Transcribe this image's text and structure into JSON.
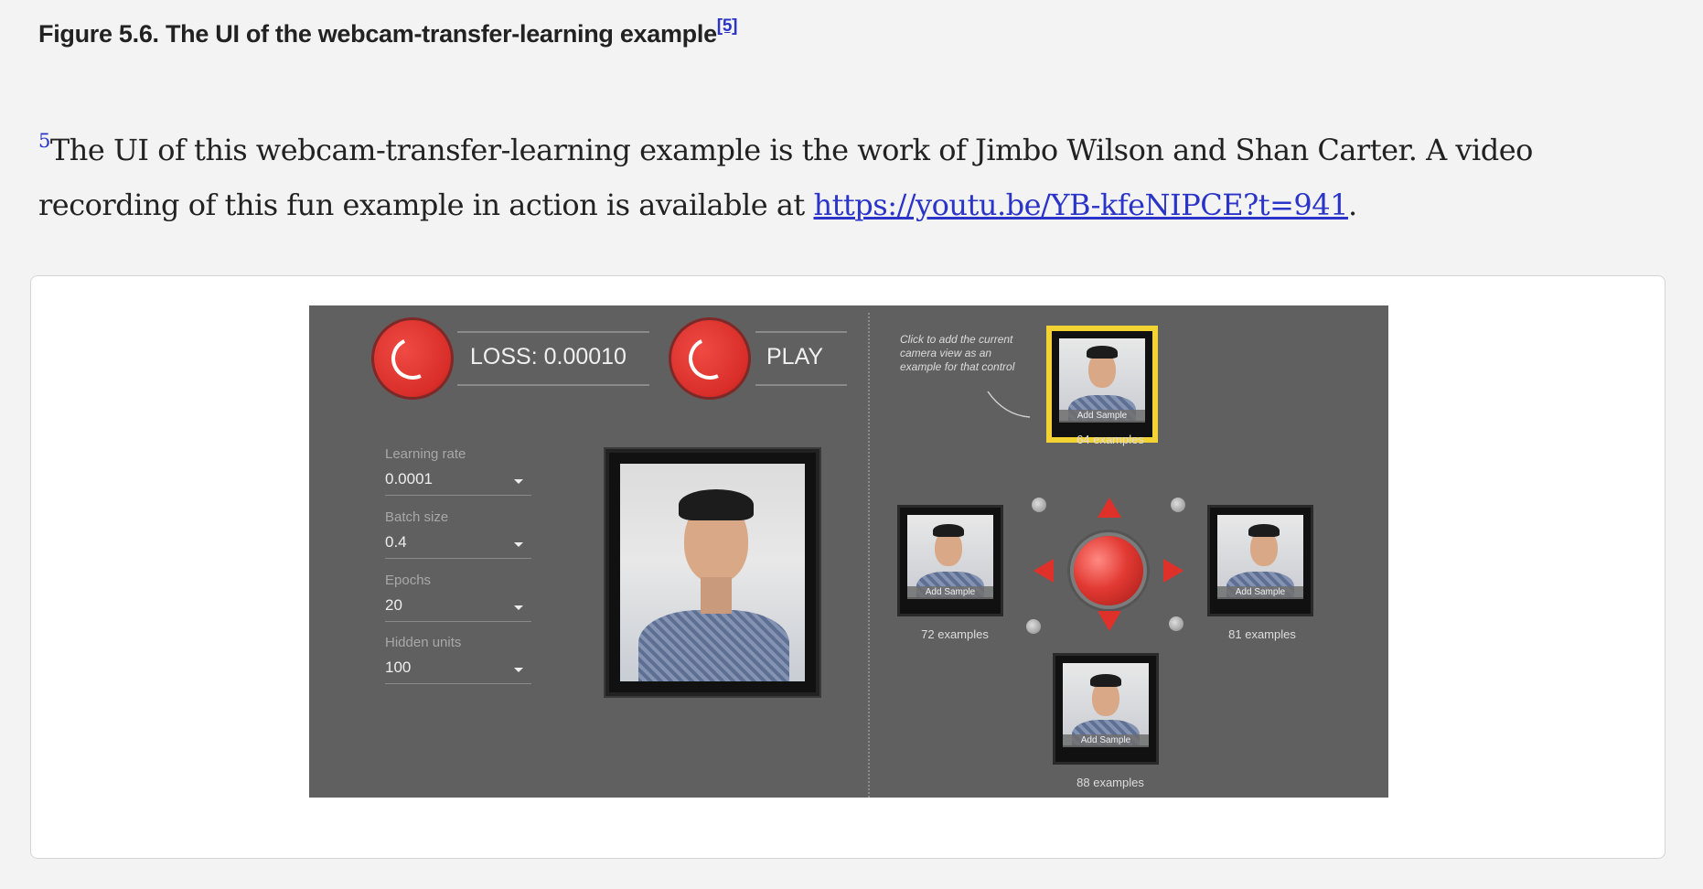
{
  "caption": {
    "text": "Figure 5.6. The UI of the webcam-transfer-learning example",
    "ref": "[5]"
  },
  "footnote": {
    "marker": "5",
    "text": "The UI of this webcam-transfer-learning example is the work of Jimbo Wilson and Shan Carter. A video recording of this fun example in action is available at ",
    "link": "https://youtu.be/YB-kfeNIPCE?t=941",
    "end": "."
  },
  "screenshot": {
    "loss_label": "LOSS: 0.00010",
    "play_label": "PLAY",
    "params": [
      {
        "label": "Learning rate",
        "value": "0.0001"
      },
      {
        "label": "Batch size",
        "value": "0.4"
      },
      {
        "label": "Epochs",
        "value": "20"
      },
      {
        "label": "Hidden units",
        "value": "100"
      }
    ],
    "hint": "Click to add the current camera view as an example for that control",
    "add_sample": "Add Sample",
    "counts": {
      "up": "64 examples",
      "left": "72 examples",
      "right": "81 examples",
      "down": "88 examples"
    },
    "colors": {
      "accent": "#e0302a",
      "selected": "#f3d233",
      "panel": "#606060"
    }
  }
}
